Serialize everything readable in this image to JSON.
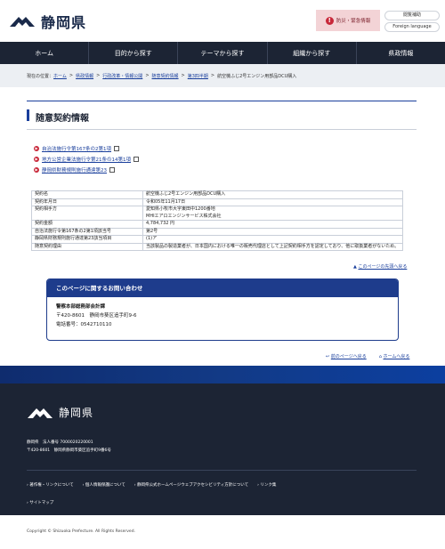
{
  "header": {
    "site_name": "静岡県",
    "disaster_label": "防災・緊急情報",
    "links": [
      "閲覧補助",
      "Foreign language"
    ]
  },
  "nav": [
    "ホーム",
    "目的から探す",
    "テーマから探す",
    "組織から探す",
    "県政情報"
  ],
  "breadcrumb": {
    "label": "現在の位置：",
    "links": [
      "ホーム",
      "県政情報",
      "行政改革・情報公開",
      "随意契約情報",
      "第3四半期"
    ],
    "current": "航空機ふじ2号エンジン用部品DCU購入"
  },
  "page_title": "随意契約情報",
  "laws": [
    "自治法施行令第167条の2第1項",
    "地方公営企業法施行令第21条の14第1項",
    "静岡県財務規則施行通達第23"
  ],
  "table": [
    [
      "契約名",
      "航空機ふじ2号エンジン用部品DCU購入"
    ],
    [
      "契約年月日",
      "令和05年11月17日"
    ],
    [
      "契約相手方",
      "愛知県小牧市大字東田中1200番地\nMHIエアロエンジンサービス株式会社"
    ],
    [
      "契約金額",
      "4,784,732 円"
    ],
    [
      "自治法施行令第167条の2第1項該当号",
      "第2号"
    ],
    [
      "静岡県財務規則施行通達第23該当項目",
      "(1)ア"
    ],
    [
      "随意契約理由",
      "当該製品の製造業者が、日本国内における唯一の販売代理店として上記契約相手方を認定しており、他に取扱業者がないため。"
    ]
  ],
  "to_top": "このページの先頭へ戻る",
  "contact": {
    "heading": "このページに関するお問い合わせ",
    "dept": "警察本部総務部会計課",
    "address": "〒420-8601　静岡市葵区追手町9-6",
    "phone": "電話番号：0542710110"
  },
  "page_links": {
    "prev": "前のページへ戻る",
    "home": "ホームへ戻る"
  },
  "footer": {
    "site_name": "静岡県",
    "corp": "静岡県　法人番号 7000020220001",
    "address": "〒420-8601　静岡県静岡市葵区追手町9番6号",
    "links": [
      "著作権・リンクについて",
      "個人情報保護について",
      "静岡県公式ホームページウェブアクセシビリティ方針について",
      "リンク集",
      "サイトマップ"
    ],
    "copyright": "Copyright © Shizuoka Prefecture. All Rights Reserved."
  },
  "colors": {
    "nav_bg": "#1c2434",
    "accent": "#1a3f9c",
    "alert_bg": "#f3d3d6",
    "footer_bg": "#1c2434"
  }
}
